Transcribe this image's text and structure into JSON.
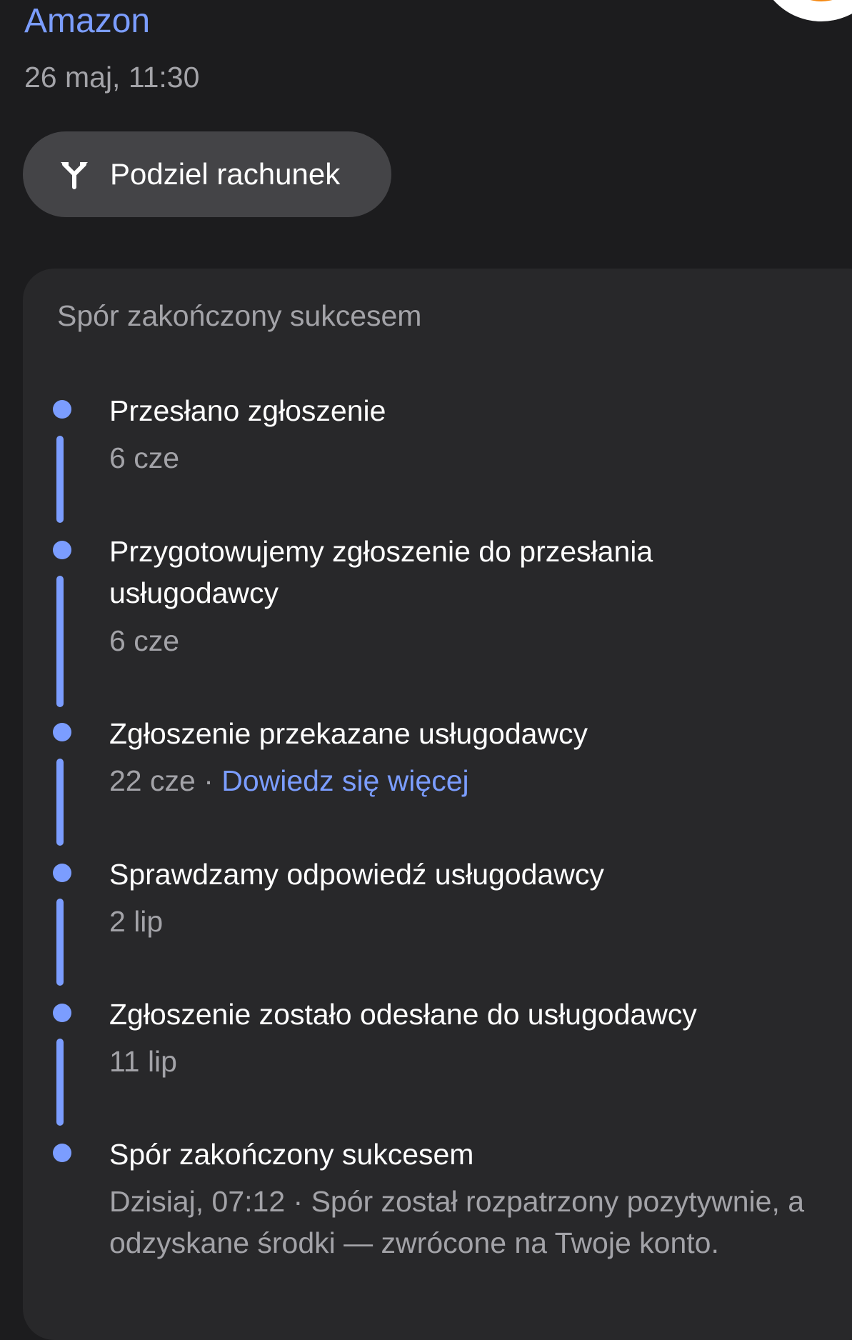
{
  "header": {
    "merchant": "Amazon",
    "date": "26 maj, 11:30"
  },
  "actions": {
    "split_label": "Podziel rachunek",
    "split_icon": "split-arrows-icon"
  },
  "dispute": {
    "title": "Spór zakończony sukcesem",
    "steps": [
      {
        "title": "Przesłano zgłoszenie",
        "date": "6 cze"
      },
      {
        "title": "Przygotowujemy zgłoszenie do przesłania usługodawcy",
        "date": "6 cze"
      },
      {
        "title": "Zgłoszenie przekazane usługodawcy",
        "date": "22 cze",
        "separator": " · ",
        "link": "Dowiedz się więcej"
      },
      {
        "title": "Sprawdzamy odpowiedź usługodawcy",
        "date": "2 lip"
      },
      {
        "title": "Zgłoszenie zostało odesłane do usługodawcy",
        "date": "11 lip"
      },
      {
        "title": "Spór zakończony sukcesem",
        "date": "Dzisiaj, 07:12",
        "separator": " · ",
        "note": "Spór został rozpatrzony pozytywnie, a odzyskane środki — zwrócone na Twoje konto."
      }
    ]
  },
  "colors": {
    "accent": "#7b9dff",
    "background": "#1c1c1e",
    "card": "#28282a",
    "button": "#444447",
    "secondary_text": "#a3a3a8",
    "avatar": "#f58a15"
  }
}
